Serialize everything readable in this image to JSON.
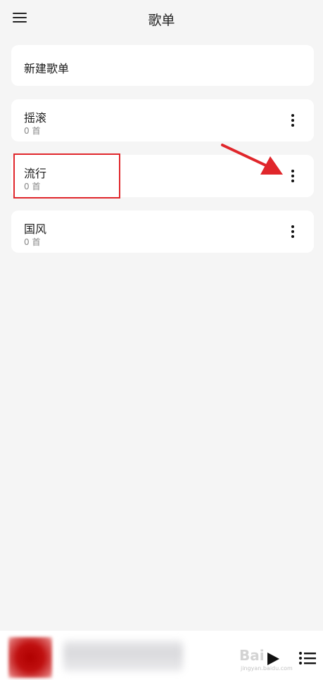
{
  "header": {
    "title": "歌单",
    "menu_icon": "hamburger-menu-icon"
  },
  "new_playlist": {
    "label": "新建歌单"
  },
  "playlists": [
    {
      "name": "摇滚",
      "count": "0 首",
      "more_icon": "more-vertical-icon"
    },
    {
      "name": "流行",
      "count": "0 首",
      "more_icon": "more-vertical-icon"
    },
    {
      "name": "国风",
      "count": "0 首",
      "more_icon": "more-vertical-icon"
    }
  ],
  "annotation": {
    "highlight_color": "#e0262b",
    "arrow_color": "#e0262b"
  },
  "player": {
    "play_icon": "play-icon",
    "queue_icon": "playlist-queue-icon"
  },
  "watermark": {
    "text": "Bai",
    "sub": "jingyan.baidu.com"
  },
  "colors": {
    "background": "#f5f5f5",
    "card": "#ffffff",
    "secondary_text": "#888888"
  }
}
